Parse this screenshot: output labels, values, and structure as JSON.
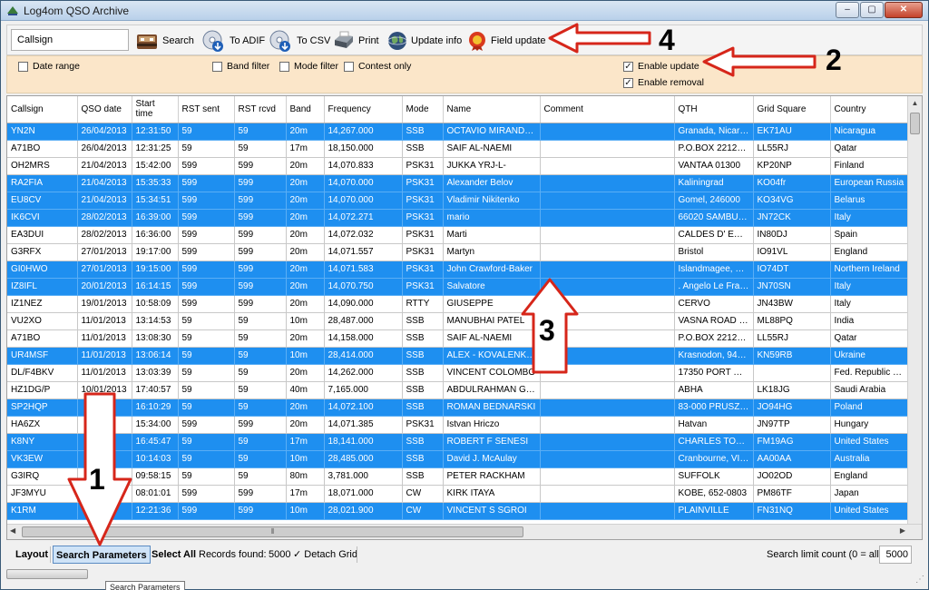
{
  "window": {
    "title": "Log4om QSO Archive",
    "controls": [
      "–",
      "▢",
      "✕"
    ]
  },
  "toolbar": {
    "callsign_placeholder": "Callsign",
    "search_label": "Search",
    "to_adif_label": "To ADIF",
    "to_csv_label": "To CSV",
    "print_label": "Print",
    "update_info_label": "Update info",
    "field_update_label": "Field update"
  },
  "filters": {
    "date_range": "Date range",
    "band_filter": "Band filter",
    "mode_filter": "Mode filter",
    "contest_only": "Contest only",
    "enable_update": "Enable update",
    "enable_removal": "Enable removal"
  },
  "grid": {
    "columns": [
      {
        "key": "callsign",
        "label": "Callsign"
      },
      {
        "key": "date",
        "label": "QSO date"
      },
      {
        "key": "start",
        "label": "Start time"
      },
      {
        "key": "rst_sent",
        "label": "RST sent"
      },
      {
        "key": "rst_rcvd",
        "label": "RST rcvd"
      },
      {
        "key": "band",
        "label": "Band"
      },
      {
        "key": "freq",
        "label": "Frequency"
      },
      {
        "key": "mode",
        "label": "Mode"
      },
      {
        "key": "name",
        "label": "Name"
      },
      {
        "key": "comment",
        "label": "Comment"
      },
      {
        "key": "qth",
        "label": "QTH"
      },
      {
        "key": "grid",
        "label": "Grid Square"
      },
      {
        "key": "country",
        "label": "Country"
      }
    ],
    "rows": [
      {
        "sel": true,
        "callsign": "YN2N",
        "date": "26/04/2013",
        "start": "12:31:50",
        "rst_sent": "59",
        "rst_rcvd": "59",
        "band": "20m",
        "freq": "14,267.000",
        "mode": "SSB",
        "name": "OCTAVIO MIRANDA L",
        "comment": "",
        "qth": "Granada, Nicara...",
        "grid": "EK71AU",
        "country": "Nicaragua"
      },
      {
        "sel": false,
        "callsign": "A71BO",
        "date": "26/04/2013",
        "start": "12:31:25",
        "rst_sent": "59",
        "rst_rcvd": "59",
        "band": "17m",
        "freq": "18,150.000",
        "mode": "SSB",
        "name": "SAIF AL-NAEMI",
        "comment": "",
        "qth": "P.O.BOX 22122, ...",
        "grid": "LL55RJ",
        "country": "Qatar"
      },
      {
        "sel": false,
        "callsign": "OH2MRS",
        "date": "21/04/2013",
        "start": "15:42:00",
        "rst_sent": "599",
        "rst_rcvd": "599",
        "band": "20m",
        "freq": "14,070.833",
        "mode": "PSK31",
        "name": "JUKKA YRJ-L-",
        "comment": "",
        "qth": "VANTAA 01300",
        "grid": "KP20NP",
        "country": "Finland"
      },
      {
        "sel": true,
        "callsign": "RA2FIA",
        "date": "21/04/2013",
        "start": "15:35:33",
        "rst_sent": "599",
        "rst_rcvd": "599",
        "band": "20m",
        "freq": "14,070.000",
        "mode": "PSK31",
        "name": "Alexander Belov",
        "comment": "",
        "qth": "Kaliningrad",
        "grid": "KO04fr",
        "country": "European Russia"
      },
      {
        "sel": true,
        "callsign": "EU8CV",
        "date": "21/04/2013",
        "start": "15:34:51",
        "rst_sent": "599",
        "rst_rcvd": "599",
        "band": "20m",
        "freq": "14,070.000",
        "mode": "PSK31",
        "name": "Vladimir Nikitenko",
        "comment": "",
        "qth": "Gomel, 246000",
        "grid": "KO34VG",
        "country": "Belarus"
      },
      {
        "sel": true,
        "callsign": "IK6CVI",
        "date": "28/02/2013",
        "start": "16:39:00",
        "rst_sent": "599",
        "rst_rcvd": "599",
        "band": "20m",
        "freq": "14,072.271",
        "mode": "PSK31",
        "name": "mario",
        "comment": "",
        "qth": "66020 SAMBUC...",
        "grid": "JN72CK",
        "country": "Italy"
      },
      {
        "sel": false,
        "callsign": "EA3DUI",
        "date": "28/02/2013",
        "start": "16:36:00",
        "rst_sent": "599",
        "rst_rcvd": "599",
        "band": "20m",
        "freq": "14,072.032",
        "mode": "PSK31",
        "name": "Marti",
        "comment": "",
        "qth": "CALDES D' EST...",
        "grid": "IN80DJ",
        "country": "Spain"
      },
      {
        "sel": false,
        "callsign": "G3RFX",
        "date": "27/01/2013",
        "start": "19:17:00",
        "rst_sent": "599",
        "rst_rcvd": "599",
        "band": "20m",
        "freq": "14,071.557",
        "mode": "PSK31",
        "name": "Martyn",
        "comment": "",
        "qth": "Bristol",
        "grid": "IO91VL",
        "country": "England"
      },
      {
        "sel": true,
        "callsign": "GI0HWO",
        "date": "27/01/2013",
        "start": "19:15:00",
        "rst_sent": "599",
        "rst_rcvd": "599",
        "band": "20m",
        "freq": "14,071.583",
        "mode": "PSK31",
        "name": "John Crawford-Baker",
        "comment": "",
        "qth": "Islandmagee, Co...",
        "grid": "IO74DT",
        "country": "Northern Ireland"
      },
      {
        "sel": true,
        "callsign": "IZ8IFL",
        "date": "20/01/2013",
        "start": "16:14:15",
        "rst_sent": "599",
        "rst_rcvd": "599",
        "band": "20m",
        "freq": "14,070.750",
        "mode": "PSK31",
        "name": "Salvatore",
        "comment": "",
        "qth": ". Angelo Le Fratte",
        "grid": "JN70SN",
        "country": "Italy"
      },
      {
        "sel": false,
        "callsign": "IZ1NEZ",
        "date": "19/01/2013",
        "start": "10:58:09",
        "rst_sent": "599",
        "rst_rcvd": "599",
        "band": "20m",
        "freq": "14,090.000",
        "mode": "RTTY",
        "name": "GIUSEPPE",
        "comment": "",
        "qth": "CERVO",
        "grid": "JN43BW",
        "country": "Italy"
      },
      {
        "sel": false,
        "callsign": "VU2XO",
        "date": "11/01/2013",
        "start": "13:14:53",
        "rst_sent": "59",
        "rst_rcvd": "59",
        "band": "10m",
        "freq": "28,487.000",
        "mode": "SSB",
        "name": "MANUBHAI PATEL",
        "comment": "",
        "qth": "VASNA ROAD B...",
        "grid": "ML88PQ",
        "country": "India"
      },
      {
        "sel": false,
        "callsign": "A71BO",
        "date": "11/01/2013",
        "start": "13:08:30",
        "rst_sent": "59",
        "rst_rcvd": "59",
        "band": "20m",
        "freq": "14,158.000",
        "mode": "SSB",
        "name": "SAIF AL-NAEMI",
        "comment": "",
        "qth": "P.O.BOX 22122, ...",
        "grid": "LL55RJ",
        "country": "Qatar"
      },
      {
        "sel": true,
        "callsign": "UR4MSF",
        "date": "11/01/2013",
        "start": "13:06:14",
        "rst_sent": "59",
        "rst_rcvd": "59",
        "band": "10m",
        "freq": "28,414.000",
        "mode": "SSB",
        "name": "ALEX - KOVALENKO ...",
        "comment": "",
        "qth": "Krasnodon, 9444...",
        "grid": "KN59RB",
        "country": "Ukraine"
      },
      {
        "sel": false,
        "callsign": "DL/F4BKV",
        "date": "11/01/2013",
        "start": "13:03:39",
        "rst_sent": "59",
        "rst_rcvd": "59",
        "band": "20m",
        "freq": "14,262.000",
        "mode": "SSB",
        "name": "VINCENT COLOMBO",
        "comment": "",
        "qth": "17350 PORT D'E...",
        "grid": "",
        "country": "Fed. Republic of ..."
      },
      {
        "sel": false,
        "callsign": "HZ1DG/P",
        "date": "10/01/2013",
        "start": "17:40:57",
        "rst_sent": "59",
        "rst_rcvd": "59",
        "band": "40m",
        "freq": "7,165.000",
        "mode": "SSB",
        "name": "ABDULRAHMAN G.A...",
        "comment": "",
        "qth": "ABHA",
        "grid": "LK18JG",
        "country": "Saudi Arabia"
      },
      {
        "sel": true,
        "callsign": "SP2HQP",
        "date": "",
        "start": "16:10:29",
        "rst_sent": "59",
        "rst_rcvd": "59",
        "band": "20m",
        "freq": "14,072.100",
        "mode": "SSB",
        "name": "ROMAN BEDNARSKI",
        "comment": "",
        "qth": "83-000 PRUSZC...",
        "grid": "JO94HG",
        "country": "Poland"
      },
      {
        "sel": false,
        "callsign": "HA6ZX",
        "date": "",
        "start": "15:34:00",
        "rst_sent": "599",
        "rst_rcvd": "599",
        "band": "20m",
        "freq": "14,071.385",
        "mode": "PSK31",
        "name": "Istvan Hriczo",
        "comment": "",
        "qth": "Hatvan",
        "grid": "JN97TP",
        "country": "Hungary"
      },
      {
        "sel": true,
        "callsign": "K8NY",
        "date": "",
        "start": "16:45:47",
        "rst_sent": "59",
        "rst_rcvd": "59",
        "band": "17m",
        "freq": "18,141.000",
        "mode": "SSB",
        "name": "ROBERT F SENESI",
        "comment": "",
        "qth": "CHARLES TOWN",
        "grid": "FM19AG",
        "country": "United States"
      },
      {
        "sel": true,
        "callsign": "VK3EW",
        "date": "",
        "start": "10:14:03",
        "rst_sent": "59",
        "rst_rcvd": "59",
        "band": "10m",
        "freq": "28,485.000",
        "mode": "SSB",
        "name": "David J. McAulay",
        "comment": "",
        "qth": "Cranbourne, VIC ...",
        "grid": "AA00AA",
        "country": "Australia"
      },
      {
        "sel": false,
        "callsign": "G3IRQ",
        "date": "",
        "start": "09:58:15",
        "rst_sent": "59",
        "rst_rcvd": "59",
        "band": "80m",
        "freq": "3,781.000",
        "mode": "SSB",
        "name": "PETER RACKHAM",
        "comment": "",
        "qth": "SUFFOLK",
        "grid": "JO02OD",
        "country": "England"
      },
      {
        "sel": false,
        "callsign": "JF3MYU",
        "date": "",
        "start": "08:01:01",
        "rst_sent": "599",
        "rst_rcvd": "599",
        "band": "17m",
        "freq": "18,071.000",
        "mode": "CW",
        "name": "KIRK ITAYA",
        "comment": "",
        "qth": "KOBE, 652-0803",
        "grid": "PM86TF",
        "country": "Japan"
      },
      {
        "sel": true,
        "callsign": "K1RM",
        "date": "",
        "start": "12:21:36",
        "rst_sent": "599",
        "rst_rcvd": "599",
        "band": "10m",
        "freq": "28,021.900",
        "mode": "CW",
        "name": "VINCENT S SGROI",
        "comment": "",
        "qth": "PLAINVILLE",
        "grid": "FN31NQ",
        "country": "United States"
      }
    ]
  },
  "status": {
    "layout": "Layout",
    "search_parameters": "Search Parameters",
    "select_all": "Select All",
    "records_label": "Records found:",
    "records_count": "5000",
    "detach_grid": "Detach Grid",
    "limit_label": "Search limit count (0 = all)",
    "limit_value": "5000",
    "tooltip": "Search Parameters"
  },
  "annotations": {
    "n1": "1",
    "n2": "2",
    "n3": "3",
    "n4": "4",
    "color": "#d6261a"
  }
}
